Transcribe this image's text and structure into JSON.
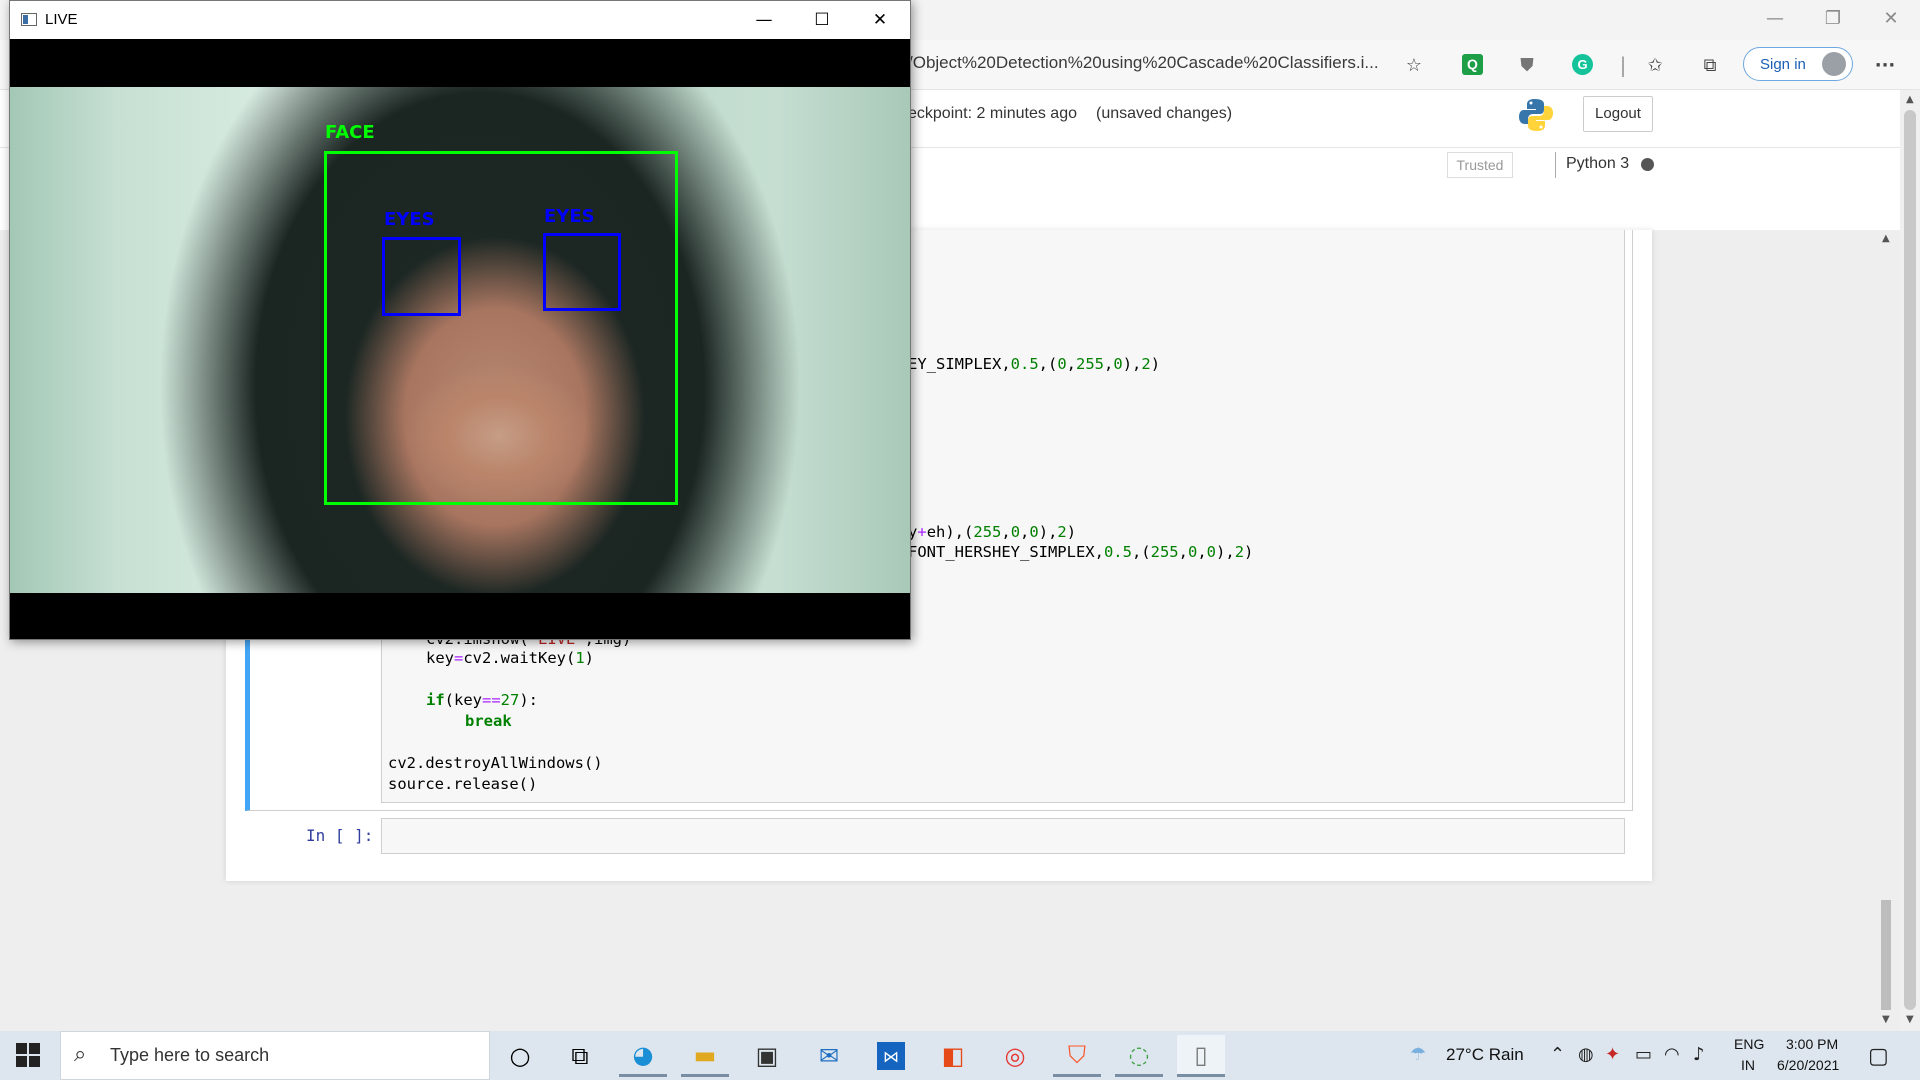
{
  "browser": {
    "url": "/Object%20Detection%20using%20Cascade%20Classifiers.i...",
    "signin_label": "Sign in",
    "more_label": "···",
    "toolbar_icons": [
      "add-favorite-icon",
      "q-extension-icon",
      "shield-extension-icon",
      "grammarly-icon",
      "favorites-icon",
      "collections-icon"
    ],
    "window_controls": {
      "minimize": "—",
      "restore": "❐",
      "close": "✕"
    }
  },
  "jupyter": {
    "checkpoint": "eckpoint: 2 minutes ago",
    "unsaved": "(unsaved changes)",
    "logout_label": "Logout",
    "trusted_label": "Trusted",
    "kernel_name": "Python 3",
    "empty_prompt": "In [ ]:",
    "code_lines": {
      "l1": "EY_SIMPLEX,",
      "l1_num1": "0.5",
      "l1_rest1": ",(",
      "l1_num2": "0",
      "l1_comma1": ",",
      "l1_num3": "255",
      "l1_comma2": ",",
      "l1_num4": "0",
      "l1_rest2": "),",
      "l1_num5": "2",
      "l1_end": ")",
      "l2_a": "y",
      "l2_op": "+",
      "l2_b": "eh),(",
      "l2_num1": "255",
      "l2_c1": ",",
      "l2_num2": "0",
      "l2_c2": ",",
      "l2_num3": "0",
      "l2_c3": "),",
      "l2_num4": "2",
      "l2_end": ")",
      "l3_a": "FONT_HERSHEY_SIMPLEX,",
      "l3_num1": "0.5",
      "l3_b": ",(",
      "l3_num2": "255",
      "l3_c1": ",",
      "l3_num3": "0",
      "l3_c2": ",",
      "l3_num4": "0",
      "l3_c3": "),",
      "l3_num5": "2",
      "l3_end": ")",
      "l4_partial": "cv2.imshow(",
      "l4_str": "'LIVE'",
      "l4_rest": ",img)",
      "l5_a": "key",
      "l5_op": "=",
      "l5_b": "cv2.waitKey(",
      "l5_num": "1",
      "l5_end": ")",
      "l6_kw": "if",
      "l6_a": "(key",
      "l6_op": "==",
      "l6_num": "27",
      "l6_end": "):",
      "l7_kw": "break",
      "l8": "cv2.destroyAllWindows()",
      "l9": "source.release()"
    }
  },
  "live_window": {
    "title": "LIVE",
    "controls": {
      "minimize": "—",
      "maximize": "☐",
      "close": "✕"
    },
    "face_label": "FACE",
    "eyes_label_left": "EYES",
    "eyes_label_right": "EYES",
    "colors": {
      "face_box": "#00ff00",
      "eyes_box": "#0000ff"
    }
  },
  "taskbar": {
    "search_placeholder": "Type here to search",
    "weather": "27°C  Rain",
    "language_top": "ENG",
    "language_bottom": "IN",
    "time": "3:00 PM",
    "date": "6/20/2021",
    "apps": [
      "cortana-icon",
      "task-view-icon",
      "edge-icon",
      "file-explorer-icon",
      "store-icon",
      "mail-icon",
      "vs-code-icon",
      "office-icon",
      "opera-icon",
      "brave-icon",
      "spinner-app-icon",
      "notepad-icon"
    ]
  }
}
